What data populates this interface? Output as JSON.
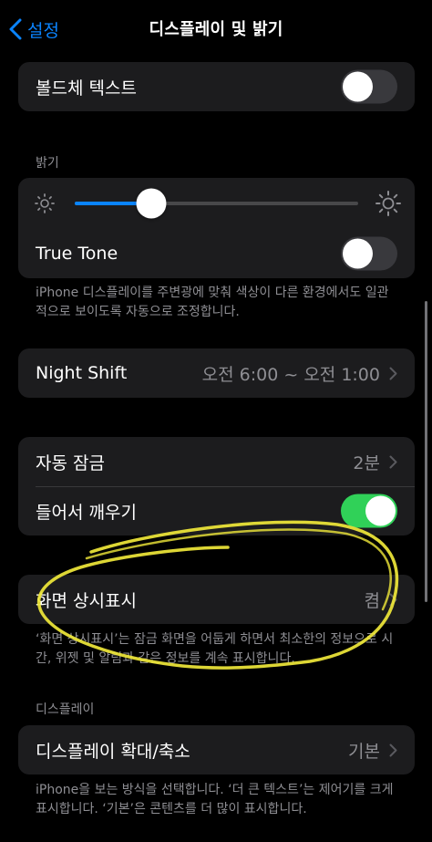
{
  "nav": {
    "back_label": "설정",
    "title": "디스플레이 및 밝기"
  },
  "bold_text": {
    "label": "볼드체 텍스트",
    "enabled": false
  },
  "brightness": {
    "header": "밝기",
    "level": 0.27,
    "true_tone": {
      "label": "True Tone",
      "enabled": false
    },
    "footer": "iPhone 디스플레이를 주변광에 맞춰 색상이 다른 환경에서도 일관적으로 보이도록 자동으로 조정합니다."
  },
  "night_shift": {
    "label": "Night Shift",
    "value": "오전 6:00 ~ 오전 1:00"
  },
  "lock": {
    "auto_lock": {
      "label": "자동 잠금",
      "value": "2분"
    },
    "raise_to_wake": {
      "label": "들어서 깨우기",
      "enabled": true
    }
  },
  "always_on": {
    "label": "화면 상시표시",
    "value": "켬",
    "footer": "‘화면 상시표시’는 잠금 화면을 어둡게 하면서 최소한의 정보으로 시간, 위젯 및 알림과 같은 정보를 계속 표시합니다."
  },
  "display": {
    "header": "디스플레이",
    "zoom": {
      "label": "디스플레이 확대/축소",
      "value": "기본"
    },
    "footer": "iPhone을 보는 방식을 선택합니다. ‘더 큰 텍스트’는 제어기를 크게 표시합니다. ‘기본’은 콘텐츠를 더 많이 표시합니다."
  },
  "colors": {
    "accent": "#0a84ff",
    "toggle_on": "#30d158",
    "annotation": "#f0e83a"
  },
  "icons": [
    "chevron-left-icon",
    "sun-small-icon",
    "sun-large-icon",
    "chevron-right-icon"
  ]
}
